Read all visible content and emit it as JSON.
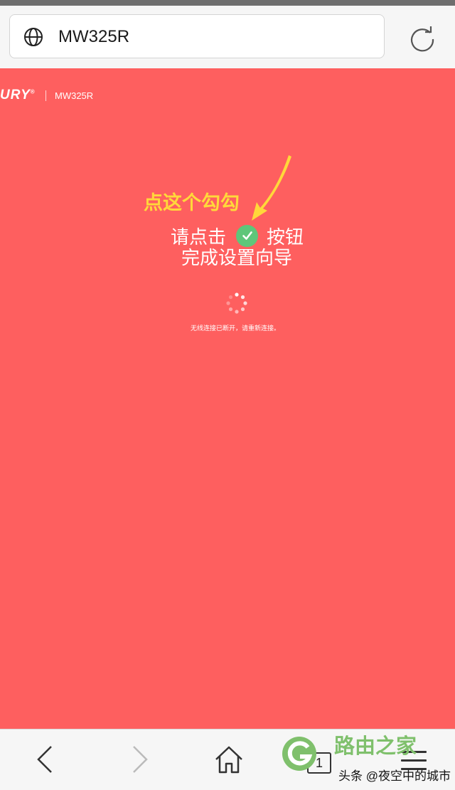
{
  "browser": {
    "url": "MW325R"
  },
  "page": {
    "brand": "URY",
    "brand_mark": "®",
    "model": "MW325R",
    "annotation": "点这个勾勾",
    "instruction": {
      "before": "请点击",
      "after": "按钮",
      "line2": "完成设置向导"
    },
    "status": "无线连接已断开，请重新连接。"
  },
  "nav": {
    "tab_count": "1"
  },
  "watermark": {
    "site": "路由之家",
    "credit": "头条 @夜空中的城市"
  },
  "colors": {
    "page_bg": "#fe5f5f",
    "annotation": "#ffd83a",
    "check_bg": "#5ec67a",
    "watermark_green": "#7fc06c"
  },
  "icons": [
    "globe-icon",
    "reload-icon",
    "arrow-annotation",
    "check-icon",
    "loading-spinner",
    "back-icon",
    "forward-icon",
    "home-icon",
    "tabs-icon",
    "menu-icon"
  ]
}
